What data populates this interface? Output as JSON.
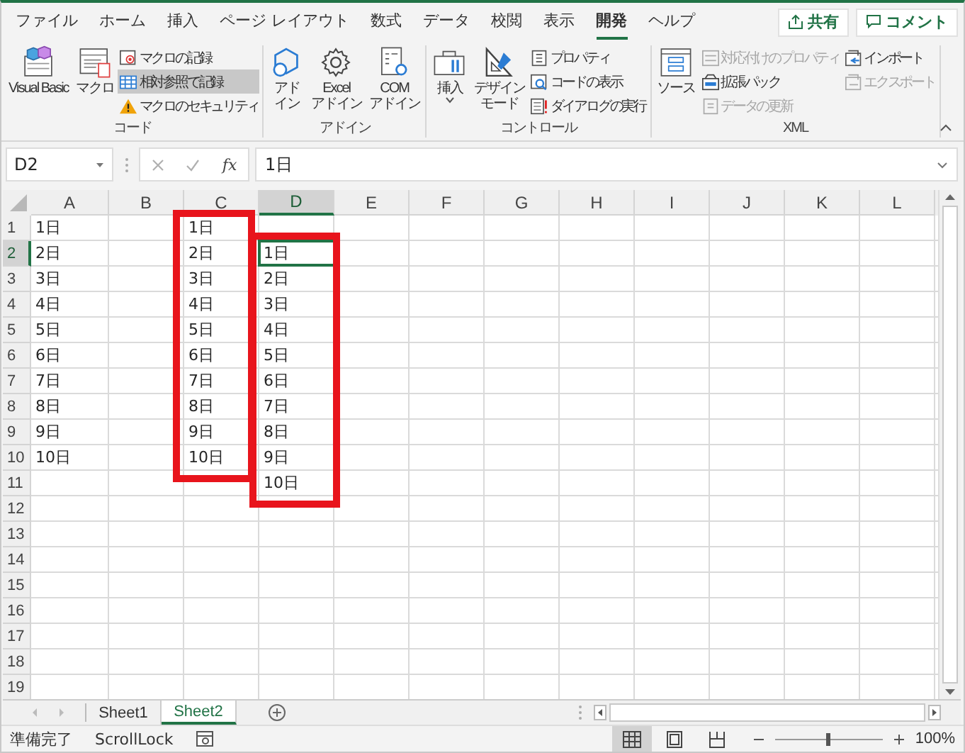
{
  "ribbon_tabs": [
    {
      "label": "ファイル",
      "selected": false
    },
    {
      "label": "ホーム",
      "selected": false
    },
    {
      "label": "挿入",
      "selected": false
    },
    {
      "label": "ページ レイアウト",
      "selected": false
    },
    {
      "label": "数式",
      "selected": false
    },
    {
      "label": "データ",
      "selected": false
    },
    {
      "label": "校閲",
      "selected": false
    },
    {
      "label": "表示",
      "selected": false
    },
    {
      "label": "開発",
      "selected": true
    },
    {
      "label": "ヘルプ",
      "selected": false
    }
  ],
  "header_buttons": [
    {
      "label": "共有"
    },
    {
      "label": "コメント"
    }
  ],
  "ribbon_groups": [
    {
      "label": "コード",
      "items": [
        {
          "kind": "large",
          "lines": [
            "Visual Basic"
          ],
          "dropdown": false
        },
        {
          "kind": "large",
          "lines": [
            "マクロ"
          ],
          "dropdown": false
        },
        {
          "kind": "small",
          "label": "マクロの記録",
          "on": false,
          "disabled": false
        },
        {
          "kind": "small",
          "label": "相対参照で記録",
          "on": true,
          "disabled": false
        },
        {
          "kind": "small",
          "label": "マクロのセキュリティ",
          "on": false,
          "disabled": false
        }
      ]
    },
    {
      "label": "アドイン",
      "items": [
        {
          "kind": "large",
          "lines": [
            "アド",
            "イン"
          ],
          "dropdown": false
        },
        {
          "kind": "large",
          "lines": [
            "Excel",
            "アドイン"
          ],
          "dropdown": false
        },
        {
          "kind": "large",
          "lines": [
            "COM",
            "アドイン"
          ],
          "dropdown": false
        }
      ]
    },
    {
      "label": "コントロール",
      "items": [
        {
          "kind": "large",
          "lines": [
            "挿入"
          ],
          "dropdown": true
        },
        {
          "kind": "large",
          "lines": [
            "デザイン",
            "モード"
          ],
          "dropdown": false
        },
        {
          "kind": "small",
          "label": "プロパティ",
          "on": false,
          "disabled": false
        },
        {
          "kind": "small",
          "label": "コードの表示",
          "on": false,
          "disabled": false
        },
        {
          "kind": "small",
          "label": "ダイアログの実行",
          "on": false,
          "disabled": false
        }
      ]
    },
    {
      "label": "XML",
      "items": [
        {
          "kind": "large",
          "lines": [
            "ソース"
          ],
          "dropdown": false
        },
        {
          "kind": "small",
          "label": "対応付けのプロパティ",
          "on": false,
          "disabled": true
        },
        {
          "kind": "small",
          "label": "拡張パック",
          "on": false,
          "disabled": false
        },
        {
          "kind": "small",
          "label": "データの更新",
          "on": false,
          "disabled": true
        },
        {
          "kind": "small",
          "label": "インポート",
          "on": false,
          "disabled": false
        },
        {
          "kind": "small",
          "label": "エクスポート",
          "on": false,
          "disabled": true
        }
      ]
    }
  ],
  "formula_bar": {
    "name_box": "D2",
    "function_label": "fx",
    "value": "1日"
  },
  "grid": {
    "columns": [
      {
        "label": "A",
        "selected": false
      },
      {
        "label": "B",
        "selected": false
      },
      {
        "label": "C",
        "selected": false
      },
      {
        "label": "D",
        "selected": true
      },
      {
        "label": "E",
        "selected": false
      },
      {
        "label": "F",
        "selected": false
      },
      {
        "label": "G",
        "selected": false
      },
      {
        "label": "H",
        "selected": false
      },
      {
        "label": "I",
        "selected": false
      },
      {
        "label": "J",
        "selected": false
      },
      {
        "label": "K",
        "selected": false
      },
      {
        "label": "L",
        "selected": false
      }
    ],
    "rows": [
      {
        "label": "1",
        "selected": false,
        "cells": [
          "1日",
          null,
          "1日"
        ]
      },
      {
        "label": "2",
        "selected": true,
        "cells": [
          "2日",
          null,
          "2日",
          "1日"
        ]
      },
      {
        "label": "3",
        "selected": false,
        "cells": [
          "3日",
          null,
          "3日",
          "2日"
        ]
      },
      {
        "label": "4",
        "selected": false,
        "cells": [
          "4日",
          null,
          "4日",
          "3日"
        ]
      },
      {
        "label": "5",
        "selected": false,
        "cells": [
          "5日",
          null,
          "5日",
          "4日"
        ]
      },
      {
        "label": "6",
        "selected": false,
        "cells": [
          "6日",
          null,
          "6日",
          "5日"
        ]
      },
      {
        "label": "7",
        "selected": false,
        "cells": [
          "7日",
          null,
          "7日",
          "6日"
        ]
      },
      {
        "label": "8",
        "selected": false,
        "cells": [
          "8日",
          null,
          "8日",
          "7日"
        ]
      },
      {
        "label": "9",
        "selected": false,
        "cells": [
          "9日",
          null,
          "9日",
          "8日"
        ]
      },
      {
        "label": "10",
        "selected": false,
        "cells": [
          "10日",
          null,
          "10日",
          "9日"
        ]
      },
      {
        "label": "11",
        "selected": false,
        "cells": [
          null,
          null,
          null,
          "10日"
        ]
      },
      {
        "label": "12",
        "selected": false
      },
      {
        "label": "13",
        "selected": false
      },
      {
        "label": "14",
        "selected": false
      },
      {
        "label": "15",
        "selected": false
      },
      {
        "label": "16",
        "selected": false
      },
      {
        "label": "17",
        "selected": false
      },
      {
        "label": "18",
        "selected": false
      },
      {
        "label": "19",
        "selected": false
      }
    ],
    "annotations": [
      {
        "kind": "frame"
      },
      {
        "kind": "frame"
      }
    ]
  },
  "sheet_tabs": [
    {
      "label": "Sheet1",
      "selected": false
    },
    {
      "label": "Sheet2",
      "selected": true
    }
  ],
  "status_bar": {
    "status": "準備完了",
    "scroll_lock": "ScrollLock",
    "views": [
      {
        "kind": "normal",
        "selected": true
      },
      {
        "kind": "page-layout",
        "selected": false
      },
      {
        "kind": "page-break",
        "selected": false
      }
    ],
    "zoom": {
      "level": 0.5,
      "reading": "100%"
    }
  }
}
